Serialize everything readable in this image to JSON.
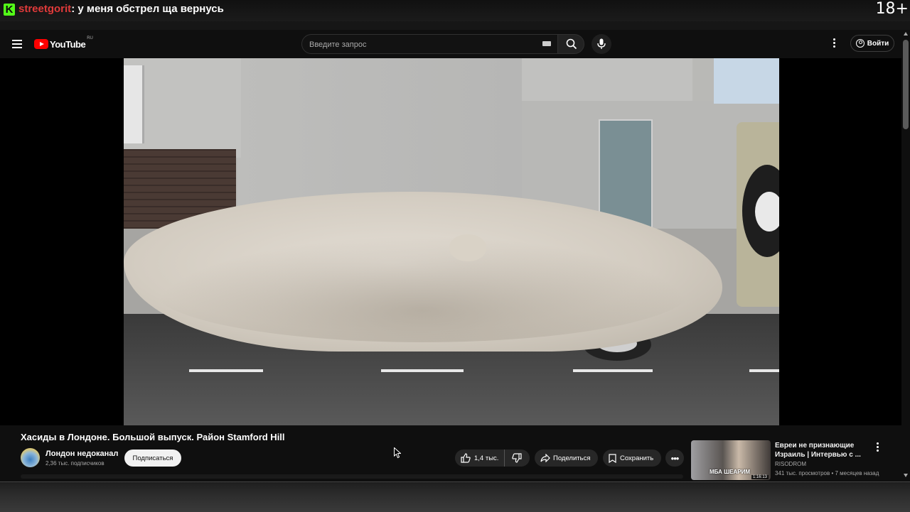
{
  "stream_overlay": {
    "platform_logo": "K",
    "chat_username": "streetgorit",
    "chat_separator": ":",
    "chat_message": " у меня обстрел ща вернусь",
    "age_rating": "18+",
    "colors": {
      "kick_green": "#53fc18",
      "username_red": "#e03a3a"
    }
  },
  "header": {
    "menu_icon": "hamburger-icon",
    "logo_text": "YouTube",
    "logo_region": "RU",
    "search_placeholder": "Введите запрос",
    "search_icon": "search-icon",
    "keyboard_icon": "keyboard-icon",
    "mic_icon": "mic-icon",
    "more_icon": "kebab-icon",
    "signin_label": "Войти",
    "colors": {
      "brand_red": "#ff0000"
    }
  },
  "video": {
    "title": "Хасиды в Лондоне. Большой выпуск. Район Stamford Hill",
    "channel_name": "Лондон недоканал",
    "channel_subscribers": "2,36 тыс. подписчиков",
    "subscribe_label": "Подписаться",
    "like_count": "1,4 тыс.",
    "share_label": "Поделиться",
    "save_label": "Сохранить",
    "more_label": "•••"
  },
  "recommendation": {
    "title": "Евреи не признающие Израиль | Интервью с ...",
    "channel": "RISODROM",
    "meta": "341 тыс. просмотров • 7 месяцев назад",
    "thumbnail_caption": "МБА ШЕАРИМ",
    "duration": "1:16:13"
  }
}
